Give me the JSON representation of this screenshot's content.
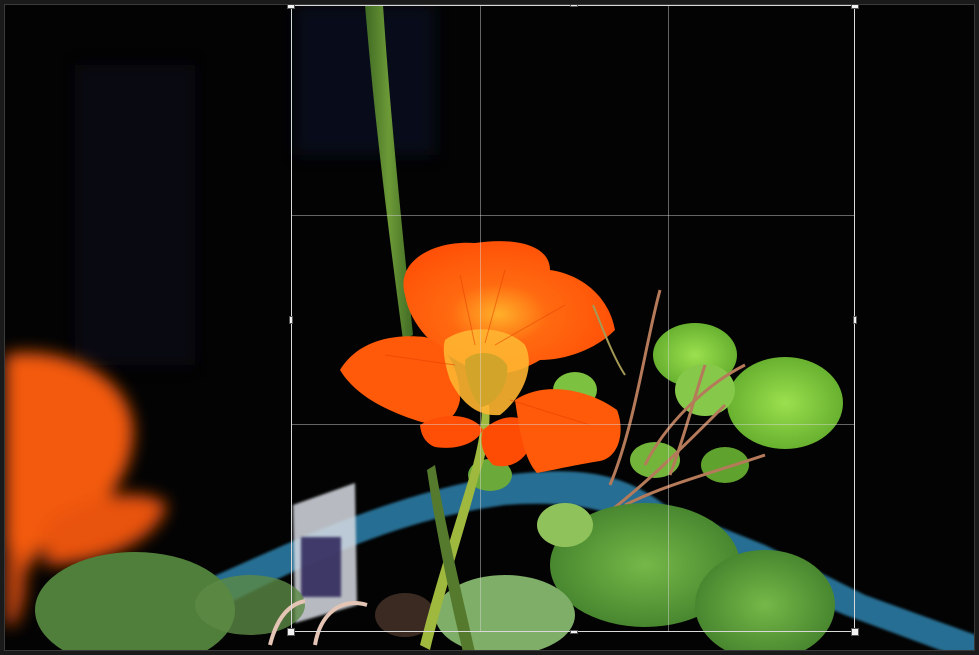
{
  "image": {
    "subject": "orange-nasturtium-flower",
    "background_color": "#030303",
    "petal_color": "#ff5a0a",
    "leaf_color": "#7cc63d",
    "planter_color": "#2e7fa8"
  },
  "crop_overlay": {
    "grid": "rule-of-thirds",
    "border_color": "#d9d9d9",
    "handle_color": "#f2f2f2"
  }
}
